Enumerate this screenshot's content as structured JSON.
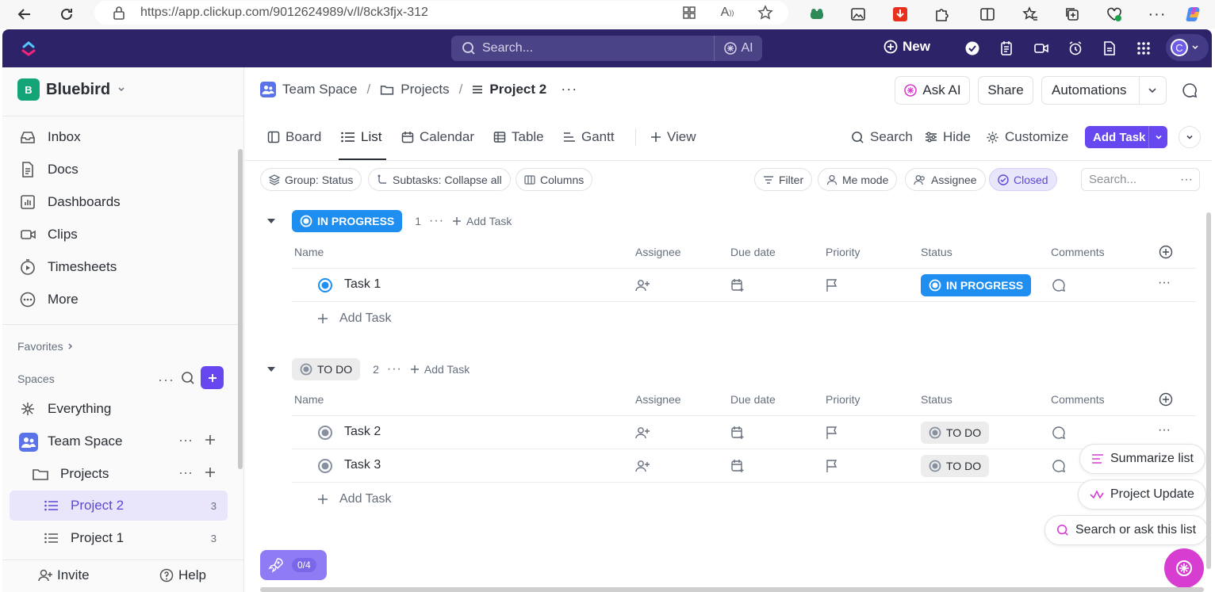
{
  "browser": {
    "url": "https://app.clickup.com/9012624989/v/l/8ck3fjx-312"
  },
  "topbar": {
    "search_placeholder": "Search...",
    "ai_label": "AI",
    "new_label": "New",
    "avatar_letter": "C"
  },
  "sidebar": {
    "workspace_letter": "B",
    "workspace_name": "Bluebird",
    "nav": [
      {
        "label": "Inbox",
        "icon": "inbox-icon"
      },
      {
        "label": "Docs",
        "icon": "docs-icon"
      },
      {
        "label": "Dashboards",
        "icon": "dashboard-icon"
      },
      {
        "label": "Clips",
        "icon": "clips-icon"
      },
      {
        "label": "Timesheets",
        "icon": "timer-icon"
      },
      {
        "label": "More",
        "icon": "more-icon"
      }
    ],
    "favorites_label": "Favorites",
    "spaces_label": "Spaces",
    "everything_label": "Everything",
    "team_space_label": "Team Space",
    "projects_label": "Projects",
    "lists": [
      {
        "label": "Project 2",
        "count": "3",
        "active": true
      },
      {
        "label": "Project 1",
        "count": "3",
        "active": false
      }
    ],
    "invite_label": "Invite",
    "help_label": "Help"
  },
  "breadcrumb": {
    "space": "Team Space",
    "folder": "Projects",
    "list": "Project 2",
    "sep": "/"
  },
  "header_actions": {
    "ask_ai": "Ask AI",
    "share": "Share",
    "automations": "Automations"
  },
  "views": {
    "tabs": [
      "Board",
      "List",
      "Calendar",
      "Table",
      "Gantt"
    ],
    "add_view": "View",
    "search": "Search",
    "hide": "Hide",
    "customize": "Customize",
    "add_task": "Add Task"
  },
  "filters": {
    "group": "Group: Status",
    "subtasks": "Subtasks: Collapse all",
    "columns": "Columns",
    "filter": "Filter",
    "me_mode": "Me mode",
    "assignee": "Assignee",
    "closed": "Closed",
    "search_placeholder": "Search..."
  },
  "columns": {
    "name": "Name",
    "assignee": "Assignee",
    "due_date": "Due date",
    "priority": "Priority",
    "status": "Status",
    "comments": "Comments"
  },
  "groups": [
    {
      "status": "IN PROGRESS",
      "count": "1",
      "add_task": "Add Task",
      "color": "#1f8ef1",
      "tasks": [
        {
          "name": "Task 1",
          "status": "IN PROGRESS"
        }
      ]
    },
    {
      "status": "TO DO",
      "count": "2",
      "add_task": "Add Task",
      "color": "#87909e",
      "tasks": [
        {
          "name": "Task 2",
          "status": "TO DO"
        },
        {
          "name": "Task 3",
          "status": "TO DO"
        }
      ]
    }
  ],
  "ai_panel": {
    "summarize": "Summarize list",
    "project_update": "Project Update",
    "search_ask": "Search or ask this list"
  },
  "onboarding": {
    "progress": "0/4"
  },
  "colors": {
    "brand_dark": "#2c2369",
    "accent": "#6647f0",
    "in_progress": "#1f8ef1",
    "todo": "#87909e"
  }
}
